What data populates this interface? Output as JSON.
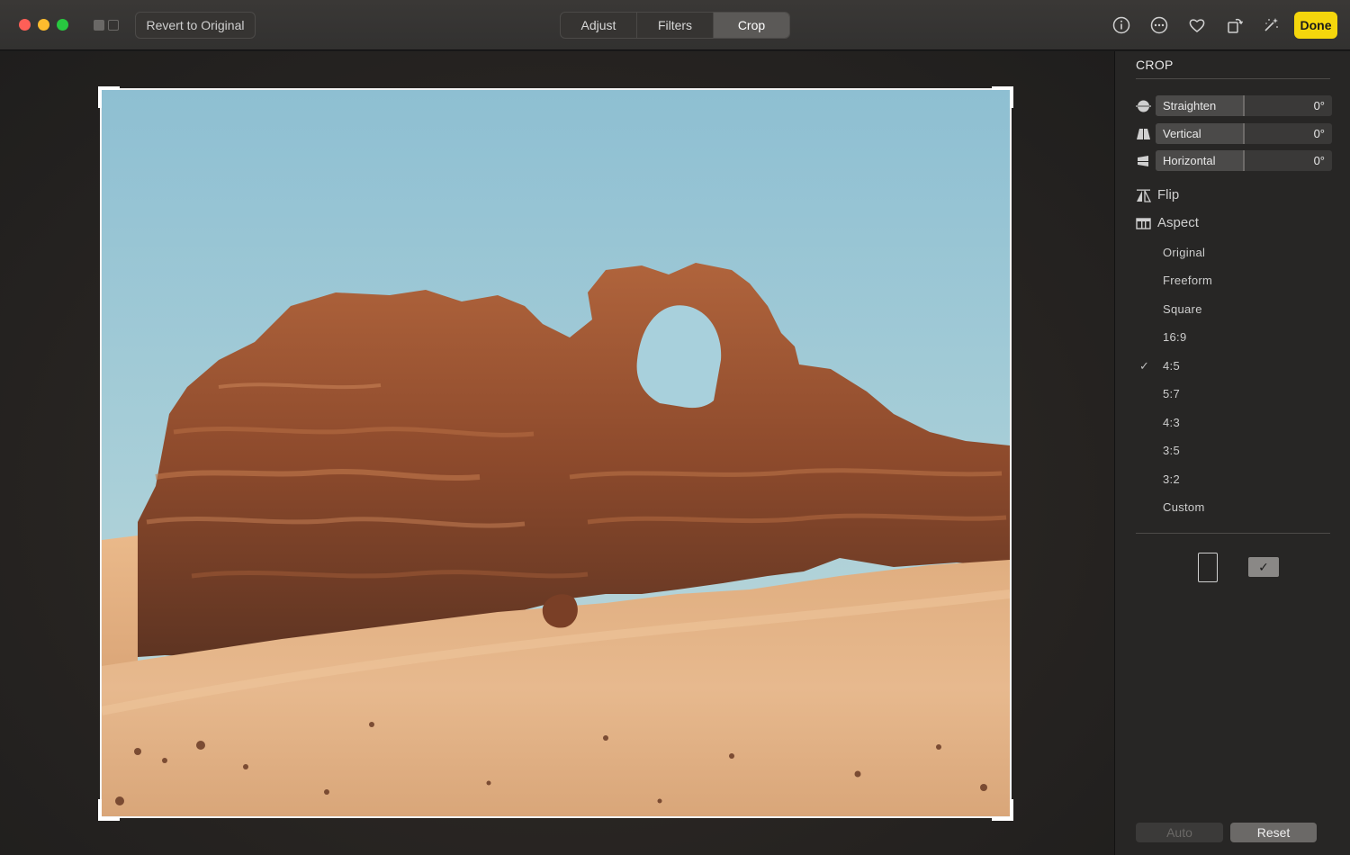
{
  "window": {
    "controls": [
      "close",
      "minimize",
      "zoom"
    ]
  },
  "toolbar": {
    "revert_label": "Revert to Original",
    "tabs": [
      {
        "label": "Adjust",
        "active": false
      },
      {
        "label": "Filters",
        "active": false
      },
      {
        "label": "Crop",
        "active": true
      }
    ],
    "icons": [
      "info-icon",
      "more-icon",
      "favorite-heart-icon",
      "rotate-icon",
      "auto-enhance-icon"
    ],
    "done_label": "Done",
    "accent_color": "#f5d60c"
  },
  "sidebar": {
    "title": "CROP",
    "sliders": [
      {
        "icon": "straighten-icon",
        "label": "Straighten",
        "value": "0°"
      },
      {
        "icon": "vertical-perspective-icon",
        "label": "Vertical",
        "value": "0°"
      },
      {
        "icon": "horizontal-perspective-icon",
        "label": "Horizontal",
        "value": "0°"
      }
    ],
    "flip_label": "Flip",
    "aspect_label": "Aspect",
    "aspect_options": [
      {
        "label": "Original",
        "selected": false
      },
      {
        "label": "Freeform",
        "selected": false
      },
      {
        "label": "Square",
        "selected": false
      },
      {
        "label": "16:9",
        "selected": false
      },
      {
        "label": "4:5",
        "selected": true
      },
      {
        "label": "5:7",
        "selected": false
      },
      {
        "label": "4:3",
        "selected": false
      },
      {
        "label": "3:5",
        "selected": false
      },
      {
        "label": "3:2",
        "selected": false
      },
      {
        "label": "Custom",
        "selected": false
      }
    ],
    "check_glyph": "✓",
    "orientation": {
      "selected": "landscape"
    },
    "auto_label": "Auto",
    "reset_label": "Reset"
  }
}
